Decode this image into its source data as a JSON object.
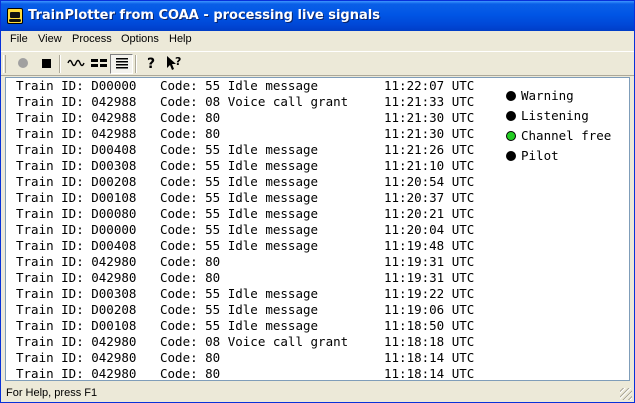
{
  "window": {
    "title": "TrainPlotter from COAA - processing live signals"
  },
  "menu": [
    "File",
    "View",
    "Process",
    "Options",
    "Help"
  ],
  "toolbar": {
    "buttons": [
      {
        "icon": "record-circle-icon",
        "pressed": false
      },
      {
        "icon": "stop-square-icon",
        "pressed": false
      },
      {
        "icon": "waveform-icon",
        "pressed": false
      },
      {
        "icon": "split-view-icon",
        "pressed": false
      },
      {
        "icon": "list-lines-icon",
        "pressed": true
      },
      {
        "icon": "help-question-icon",
        "pressed": false
      },
      {
        "icon": "context-help-pointer-icon",
        "pressed": false
      }
    ]
  },
  "log": [
    {
      "id": "Train ID: D00000",
      "code": "Code: 55 Idle message",
      "time": "11:22:07 UTC"
    },
    {
      "id": "Train ID: 042988",
      "code": "Code: 08 Voice call grant",
      "time": "11:21:33 UTC"
    },
    {
      "id": "Train ID: 042988",
      "code": "Code: 80",
      "time": "11:21:30 UTC"
    },
    {
      "id": "Train ID: 042988",
      "code": "Code: 80",
      "time": "11:21:30 UTC"
    },
    {
      "id": "Train ID: D00408",
      "code": "Code: 55 Idle message",
      "time": "11:21:26 UTC"
    },
    {
      "id": "Train ID: D00308",
      "code": "Code: 55 Idle message",
      "time": "11:21:10 UTC"
    },
    {
      "id": "Train ID: D00208",
      "code": "Code: 55 Idle message",
      "time": "11:20:54 UTC"
    },
    {
      "id": "Train ID: D00108",
      "code": "Code: 55 Idle message",
      "time": "11:20:37 UTC"
    },
    {
      "id": "Train ID: D00080",
      "code": "Code: 55 Idle message",
      "time": "11:20:21 UTC"
    },
    {
      "id": "Train ID: D00000",
      "code": "Code: 55 Idle message",
      "time": "11:20:04 UTC"
    },
    {
      "id": "Train ID: D00408",
      "code": "Code: 55 Idle message",
      "time": "11:19:48 UTC"
    },
    {
      "id": "Train ID: 042980",
      "code": "Code: 80",
      "time": "11:19:31 UTC"
    },
    {
      "id": "Train ID: 042980",
      "code": "Code: 80",
      "time": "11:19:31 UTC"
    },
    {
      "id": "Train ID: D00308",
      "code": "Code: 55 Idle message",
      "time": "11:19:22 UTC"
    },
    {
      "id": "Train ID: D00208",
      "code": "Code: 55 Idle message",
      "time": "11:19:06 UTC"
    },
    {
      "id": "Train ID: D00108",
      "code": "Code: 55 Idle message",
      "time": "11:18:50 UTC"
    },
    {
      "id": "Train ID: 042980",
      "code": "Code: 08 Voice call grant",
      "time": "11:18:18 UTC"
    },
    {
      "id": "Train ID: 042980",
      "code": "Code: 80",
      "time": "11:18:14 UTC"
    },
    {
      "id": "Train ID: 042980",
      "code": "Code: 80",
      "time": "11:18:14 UTC"
    }
  ],
  "indicators": [
    {
      "label": "Warning",
      "color": "#000000"
    },
    {
      "label": "Listening",
      "color": "#000000"
    },
    {
      "label": "Channel free",
      "color": "#22cc22"
    },
    {
      "label": "Pilot",
      "color": "#000000"
    }
  ],
  "statusbar": {
    "text": "For Help, press F1"
  },
  "colors": {
    "titlebar": "#0055e5",
    "chrome": "#ece9d8",
    "led_on": "#22cc22",
    "led_off": "#000000"
  }
}
